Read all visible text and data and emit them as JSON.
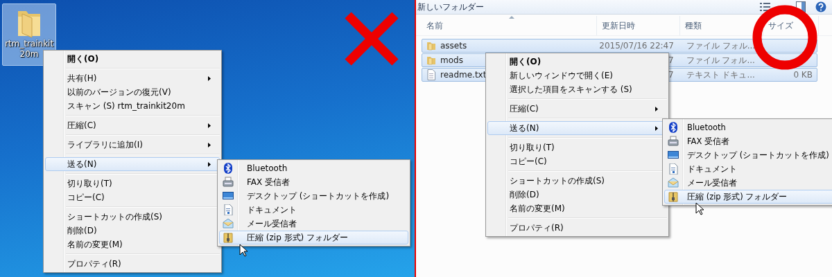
{
  "left": {
    "desktop_icon": {
      "label": "rtm_trainkit20m",
      "selected": true
    },
    "context_menu": {
      "groups": [
        [
          {
            "label": "開く(O)",
            "bold": true,
            "submenu": false,
            "selected": false
          }
        ],
        [
          {
            "label": "共有(H)",
            "bold": false,
            "submenu": true,
            "selected": false
          },
          {
            "label": "以前のバージョンの復元(V)",
            "bold": false,
            "submenu": false,
            "selected": false
          },
          {
            "label": "スキャン (S) rtm_trainkit20m",
            "bold": false,
            "submenu": false,
            "selected": false
          }
        ],
        [
          {
            "label": "圧縮(C)",
            "bold": false,
            "submenu": true,
            "selected": false
          }
        ],
        [
          {
            "label": "ライブラリに追加(I)",
            "bold": false,
            "submenu": true,
            "selected": false
          }
        ],
        [
          {
            "label": "送る(N)",
            "bold": false,
            "submenu": true,
            "selected": true
          }
        ],
        [
          {
            "label": "切り取り(T)",
            "bold": false,
            "submenu": false,
            "selected": false
          },
          {
            "label": "コピー(C)",
            "bold": false,
            "submenu": false,
            "selected": false
          }
        ],
        [
          {
            "label": "ショートカットの作成(S)",
            "bold": false,
            "submenu": false,
            "selected": false
          },
          {
            "label": "削除(D)",
            "bold": false,
            "submenu": false,
            "selected": false
          },
          {
            "label": "名前の変更(M)",
            "bold": false,
            "submenu": false,
            "selected": false
          }
        ],
        [
          {
            "label": "プロパティ(R)",
            "bold": false,
            "submenu": false,
            "selected": false
          }
        ]
      ]
    },
    "submenu": {
      "items": [
        {
          "kind": "bluetooth",
          "label": "Bluetooth",
          "selected": false
        },
        {
          "kind": "fax",
          "label": "FAX 受信者",
          "selected": false
        },
        {
          "kind": "desktop",
          "label": "デスクトップ (ショートカットを作成)",
          "selected": false
        },
        {
          "kind": "document",
          "label": "ドキュメント",
          "selected": false
        },
        {
          "kind": "mail",
          "label": "メール受信者",
          "selected": false
        },
        {
          "kind": "zip",
          "label": "圧縮 (zip 形式) フォルダー",
          "selected": true
        }
      ]
    },
    "mark": {
      "kind": "cross"
    }
  },
  "right": {
    "title": "新しいフォルダー",
    "columns": [
      {
        "label": "名前",
        "sorted": true
      },
      {
        "label": "更新日時",
        "sorted": false
      },
      {
        "label": "種類",
        "sorted": false
      },
      {
        "label": "サイズ",
        "sorted": false
      }
    ],
    "rows": [
      {
        "kind": "folder",
        "name": "assets",
        "date": "2015/07/16 22:47",
        "type": "ファイル フォル...",
        "selected": true
      },
      {
        "kind": "folder",
        "name": "mods",
        "date": "7",
        "type": "ファイル フォル...",
        "selected": true
      },
      {
        "kind": "file",
        "name": "readme.txt",
        "date": "7",
        "type": "テキスト ドキュ...",
        "size": "0 KB",
        "selected": true
      }
    ],
    "context_menu": {
      "groups": [
        [
          {
            "label": "開く(O)",
            "bold": true,
            "submenu": false,
            "selected": false
          },
          {
            "label": "新しいウィンドウで開く(E)",
            "bold": false,
            "submenu": false,
            "selected": false
          },
          {
            "label": "選択した項目をスキャンする (S)",
            "bold": false,
            "submenu": false,
            "selected": false
          }
        ],
        [
          {
            "label": "圧縮(C)",
            "bold": false,
            "submenu": true,
            "selected": false
          }
        ],
        [
          {
            "label": "送る(N)",
            "bold": false,
            "submenu": true,
            "selected": true
          }
        ],
        [
          {
            "label": "切り取り(T)",
            "bold": false,
            "submenu": false,
            "selected": false
          },
          {
            "label": "コピー(C)",
            "bold": false,
            "submenu": false,
            "selected": false
          }
        ],
        [
          {
            "label": "ショートカットの作成(S)",
            "bold": false,
            "submenu": false,
            "selected": false
          },
          {
            "label": "削除(D)",
            "bold": false,
            "submenu": false,
            "selected": false
          },
          {
            "label": "名前の変更(M)",
            "bold": false,
            "submenu": false,
            "selected": false
          }
        ],
        [
          {
            "label": "プロパティ(R)",
            "bold": false,
            "submenu": false,
            "selected": false
          }
        ]
      ]
    },
    "submenu": {
      "items": [
        {
          "kind": "bluetooth",
          "label": "Bluetooth",
          "selected": false
        },
        {
          "kind": "fax",
          "label": "FAX 受信者",
          "selected": false
        },
        {
          "kind": "desktop",
          "label": "デスクトップ (ショートカットを作成)",
          "selected": false
        },
        {
          "kind": "document",
          "label": "ドキュメント",
          "selected": false
        },
        {
          "kind": "mail",
          "label": "メール受信者",
          "selected": false
        },
        {
          "kind": "zip",
          "label": "圧縮 (zip 形式) フォルダー",
          "selected": true
        }
      ]
    },
    "mark": {
      "kind": "circle"
    }
  }
}
